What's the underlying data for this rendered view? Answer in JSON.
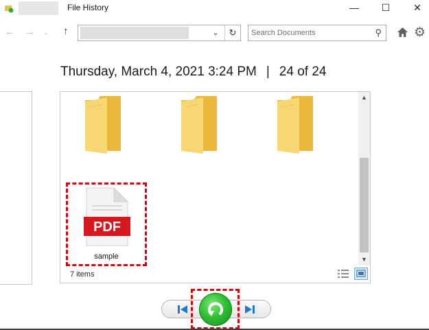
{
  "window": {
    "title": "File History",
    "minimize_glyph": "—",
    "maximize_glyph": "☐",
    "close_glyph": "✕"
  },
  "nav": {
    "back_glyph": "←",
    "forward_glyph": "→",
    "history_dropdown_glyph": "⌄",
    "up_glyph": "↑",
    "address_value": "",
    "address_dropdown_glyph": "⌄",
    "refresh_glyph": "↻",
    "search_placeholder": "Search Documents",
    "search_icon_glyph": "⚲",
    "gear_glyph": "⚙"
  },
  "snapshot": {
    "datetime": "Thursday, March 4, 2021 3:24 PM",
    "separator": "|",
    "position": "24 of 24"
  },
  "files": {
    "folders": [
      "folder",
      "folder",
      "folder"
    ],
    "items": [
      {
        "name": "sample",
        "type": "pdf",
        "badge": "PDF"
      }
    ],
    "status": "7 items"
  },
  "scrollbar": {
    "up_glyph": "▲",
    "down_glyph": "▼"
  },
  "colors": {
    "highlight": "#d9000d",
    "folder": "#f2c94c",
    "pdf_red": "#d6181e",
    "restore_green": "#2fbf33"
  }
}
